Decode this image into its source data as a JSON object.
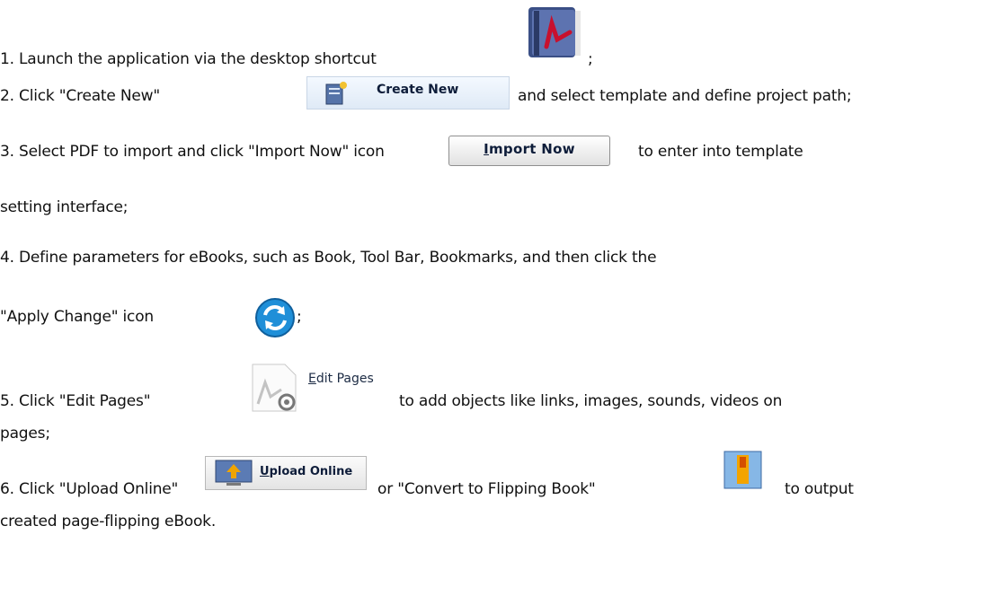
{
  "steps": {
    "s1_text": "1. Launch the application via the desktop shortcut",
    "s1_end": ";",
    "s2_text": "2. Click \"Create New\"",
    "s2_end": "and select template and define project path;",
    "s3_text": "3. Select PDF to import and click \"Import Now\" icon",
    "s3_end": "to enter into template",
    "s3_cont": "setting interface;",
    "s4_text": "4. Define parameters for eBooks, such as Book, Tool Bar, Bookmarks, and then click the",
    "s4_cont": "\"Apply Change\" icon",
    "s4_end": ";",
    "s5_text": "5. Click \"Edit Pages\"",
    "s5_end": "to add objects like links, images, sounds, videos on",
    "s5_cont": "pages;",
    "s6_text": "6. Click \"Upload Online\"",
    "s6_mid": "or \"Convert to Flipping Book\"",
    "s6_end": "to output",
    "s6_cont": "created page-flipping eBook."
  },
  "buttons": {
    "create_new": "Create New",
    "import_now_first": "I",
    "import_now_rest": "mport Now",
    "edit_pages_first": "E",
    "edit_pages_rest": "dit Pages",
    "upload_first": "U",
    "upload_rest": "pload Online"
  },
  "icons": {
    "shortcut": "book-shortcut-icon",
    "create": "new-document-icon",
    "apply": "refresh-icon",
    "edit": "pdf-gear-icon",
    "upload": "upload-monitor-icon",
    "flipping": "flipping-book-icon"
  },
  "colors": {
    "button_text": "#0e1d3a",
    "apply_blue": "#1f8fd8"
  }
}
